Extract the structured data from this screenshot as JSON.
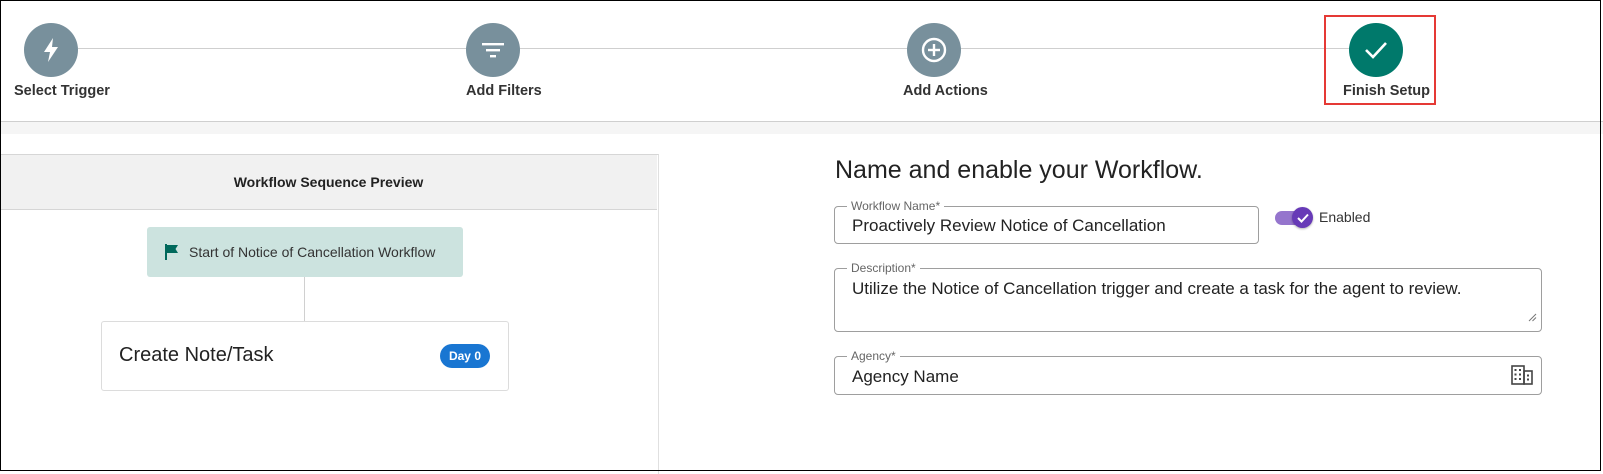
{
  "stepper": {
    "steps": [
      {
        "label": "Select Trigger",
        "icon": "lightning-icon",
        "state": "inactive"
      },
      {
        "label": "Add Filters",
        "icon": "filter-icon",
        "state": "inactive"
      },
      {
        "label": "Add Actions",
        "icon": "plus-circle-icon",
        "state": "inactive"
      },
      {
        "label": "Finish Setup",
        "icon": "check-icon",
        "state": "complete"
      }
    ]
  },
  "preview": {
    "header": "Workflow Sequence Preview",
    "start_node": "Start of Notice of Cancellation Workflow",
    "task_title": "Create Note/Task",
    "day_badge": "Day 0"
  },
  "form": {
    "title": "Name and enable your Workflow.",
    "workflow_name_label": "Workflow Name*",
    "workflow_name_value": "Proactively Review Notice of Cancellation",
    "enabled_label": "Enabled",
    "enabled": true,
    "description_label": "Description*",
    "description_value": "Utilize the Notice of Cancellation trigger and create a task for the agent to review.",
    "agency_label": "Agency*",
    "agency_value": "Agency Name"
  },
  "colors": {
    "step_inactive": "#78909c",
    "step_complete": "#00796b",
    "highlight_box": "#e53935",
    "start_node_bg": "#cce3df",
    "badge": "#1976d2",
    "toggle": "#673ab7"
  }
}
